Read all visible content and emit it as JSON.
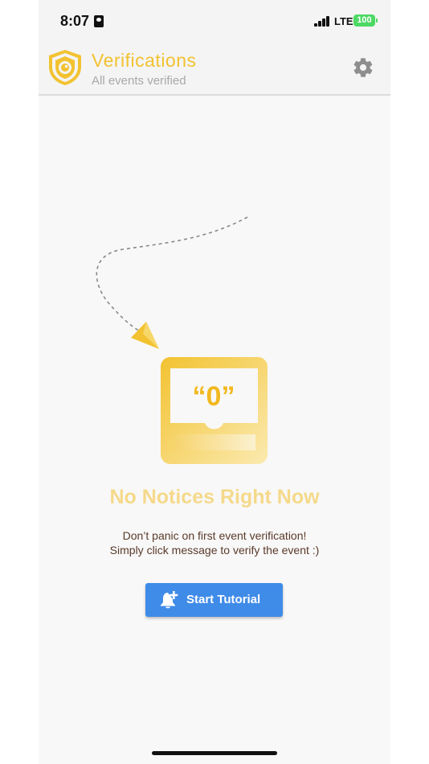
{
  "status_bar": {
    "time": "8:07",
    "network": "LTE",
    "battery": "100"
  },
  "header": {
    "title": "Verifications",
    "subtitle": "All events verified",
    "accent_color": "#f2c230"
  },
  "empty_state": {
    "counter_label": "“0”",
    "title": "No Notices Right Now",
    "message_line1": "Don’t panic on first event verification!",
    "message_line2": "Simply click message to verify the event :)"
  },
  "tutorial_button": {
    "label": "Start Tutorial",
    "icon": "bell-plus-icon",
    "color": "#3f8be8"
  },
  "icons": {
    "logo": "shield-eye-icon",
    "settings": "gear-icon"
  }
}
